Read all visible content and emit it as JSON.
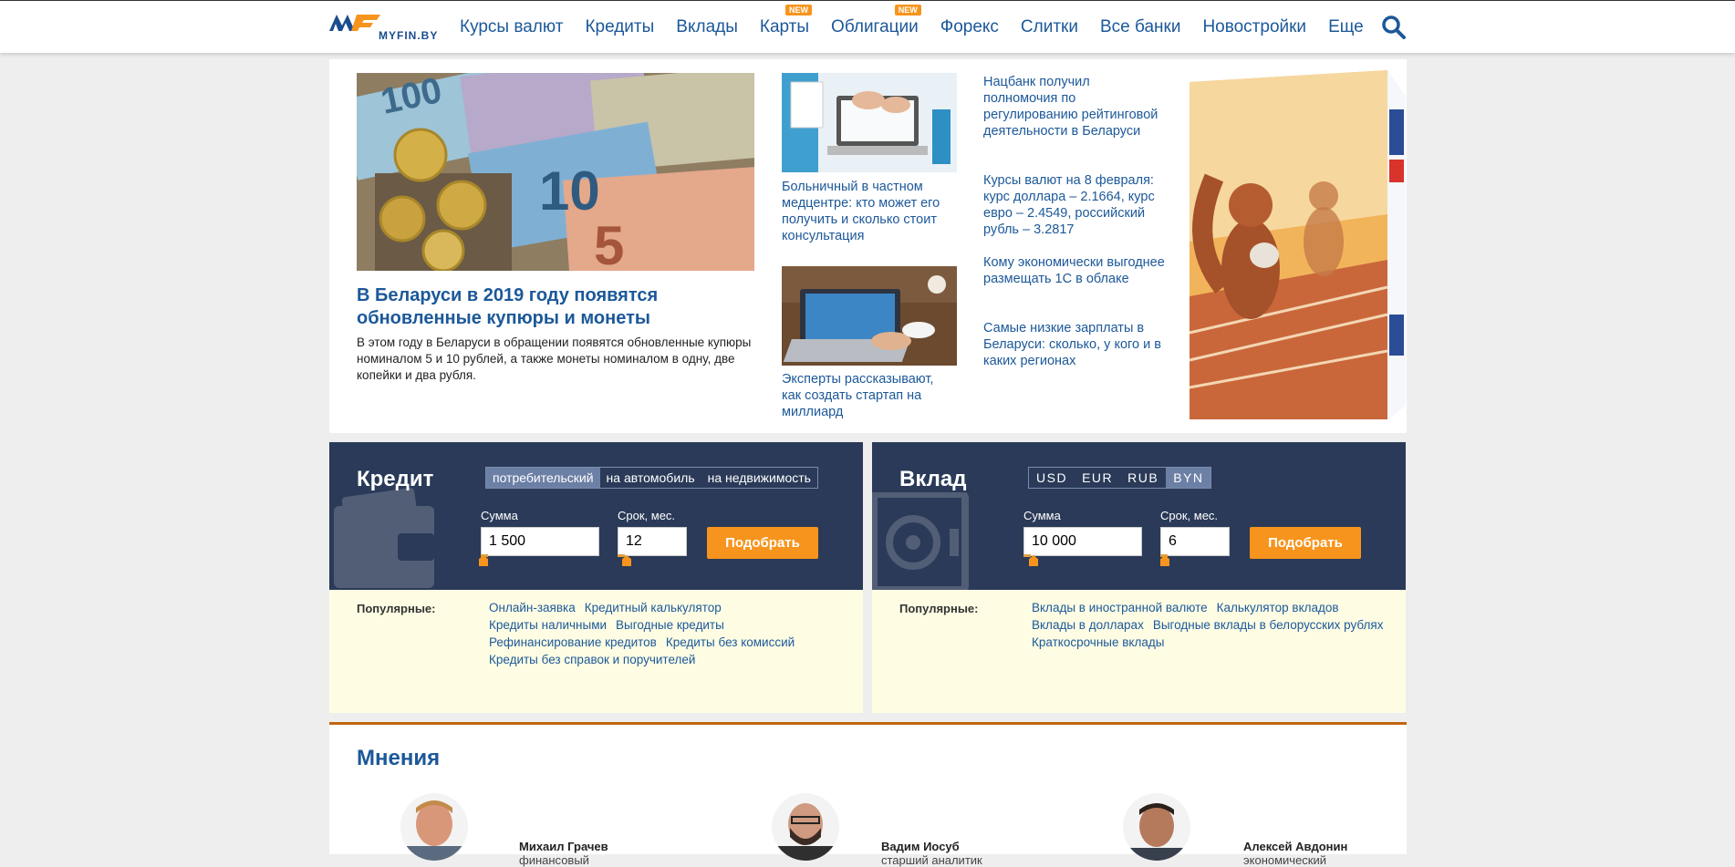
{
  "header": {
    "logo_text": "MYFIN.BY",
    "nav": [
      {
        "label": "Курсы валют",
        "badge": ""
      },
      {
        "label": "Кредиты",
        "badge": ""
      },
      {
        "label": "Вклады",
        "badge": ""
      },
      {
        "label": "Карты",
        "badge": "NEW"
      },
      {
        "label": "Облигации",
        "badge": "NEW"
      },
      {
        "label": "Форекс",
        "badge": ""
      },
      {
        "label": "Слитки",
        "badge": ""
      },
      {
        "label": "Все банки",
        "badge": ""
      },
      {
        "label": "Новостройки",
        "badge": ""
      },
      {
        "label": "Еще",
        "badge": ""
      }
    ]
  },
  "news": {
    "hero_title": "В Беларуси в 2019 году появятся обновленные купюры и монеты",
    "hero_text": "В этом году в Беларуси в обращении появятся обновленные купюры номиналом 5 и 10 рублей, а также монеты номиналом в одну, две копейки и два рубля.",
    "thumb1_caption": "Больничный в частном медцентре: кто может его получить и сколько стоит консультация",
    "thumb2_caption": "Эксперты рассказывают, как создать стартап на миллиард",
    "side": [
      "Нацбанк получил полномочия по регулированию рейтинговой деятельности в Беларуси",
      "Курсы валют на 8 февраля: курс доллара – 2.1664, курс евро – 2.4549, российский рубль – 3.2817",
      "Кому экономически выгоднее размещать 1С в облаке",
      "Самые низкие зарплаты в Беларуси: сколько, у кого и в каких регионах"
    ]
  },
  "credit": {
    "title": "Кредит",
    "tabs": [
      "потребительский",
      "на автомобиль",
      "на недвижимость"
    ],
    "active_tab": 0,
    "sum_label": "Сумма",
    "sum_value": "1 500",
    "term_label": "Срок, мес.",
    "term_value": "12",
    "button": "Подобрать",
    "popular_label": "Популярные:",
    "links": [
      "Онлайн-заявка",
      "Кредитный калькулятор",
      "Кредиты наличными",
      "Выгодные кредиты",
      "Рефинансирование кредитов",
      "Кредиты без комиссий",
      "Кредиты без справок и поручителей"
    ]
  },
  "deposit": {
    "title": "Вклад",
    "tabs": [
      "USD",
      "EUR",
      "RUB",
      "BYN"
    ],
    "active_tab": 3,
    "sum_label": "Сумма",
    "sum_value": "10 000",
    "term_label": "Срок, мес.",
    "term_value": "6",
    "button": "Подобрать",
    "popular_label": "Популярные:",
    "links": [
      "Вклады в иностранной валюте",
      "Калькулятор вкладов",
      "Вклады в долларах",
      "Выгодные вклады в белорусских рублях",
      "Краткосрочные вклады"
    ]
  },
  "opinions": {
    "title": "Мнения",
    "people": [
      {
        "name": "Михаил Грачев",
        "role": "финансовый"
      },
      {
        "name": "Вадим Иосуб",
        "role": "старший аналитик"
      },
      {
        "name": "Алексей Авдонин",
        "role": "экономический"
      }
    ]
  },
  "colors": {
    "brand": "#1c5899",
    "accent": "#f7941d",
    "widget_bg": "#2a3a58",
    "popular_bg": "#fefde4"
  }
}
